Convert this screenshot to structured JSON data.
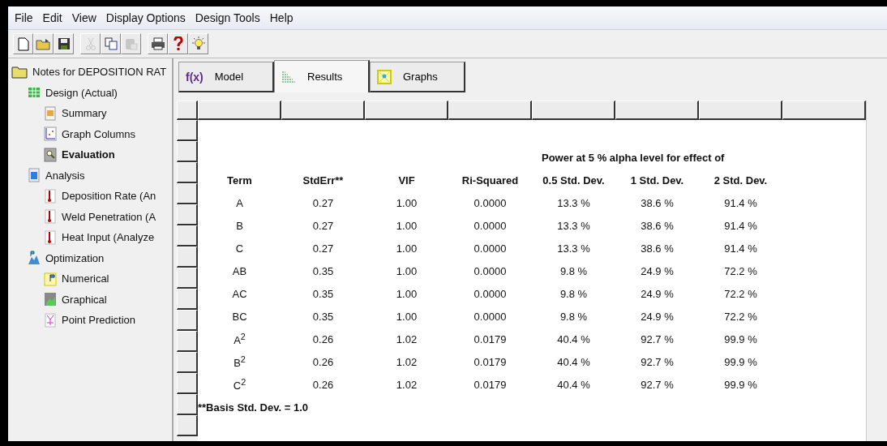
{
  "menu": [
    "File",
    "Edit",
    "View",
    "Display Options",
    "Design Tools",
    "Help"
  ],
  "toolbar": [
    [
      {
        "kind": "new",
        "disabled": false
      },
      {
        "kind": "open",
        "disabled": false
      },
      {
        "kind": "save",
        "disabled": false
      }
    ],
    [
      {
        "kind": "cut",
        "disabled": true
      },
      {
        "kind": "copy",
        "disabled": false
      },
      {
        "kind": "paste",
        "disabled": true
      }
    ],
    [
      {
        "kind": "print",
        "disabled": false
      },
      {
        "kind": "help",
        "disabled": false
      },
      {
        "kind": "tip",
        "disabled": false
      }
    ]
  ],
  "tree": {
    "label": "Notes for DEPOSITION RAT",
    "kind": "folder",
    "selected": false,
    "children": [
      {
        "label": "Design (Actual)",
        "kind": "grid",
        "selected": false,
        "children": [
          {
            "label": "Summary",
            "kind": "table",
            "selected": false
          },
          {
            "label": "Graph Columns",
            "kind": "chart",
            "selected": false
          },
          {
            "label": "Evaluation",
            "kind": "magnifier",
            "selected": true
          }
        ]
      },
      {
        "label": "Analysis",
        "kind": "calculator",
        "selected": false,
        "children": [
          {
            "label": "Deposition Rate (An",
            "kind": "thermometer",
            "selected": false
          },
          {
            "label": "Weld Penetration (A",
            "kind": "thermometer",
            "selected": false
          },
          {
            "label": "Heat Input (Analyze",
            "kind": "thermometer",
            "selected": false
          }
        ]
      },
      {
        "label": "Optimization",
        "kind": "mountain",
        "selected": false,
        "children": [
          {
            "label": "Numerical",
            "kind": "flag",
            "selected": false
          },
          {
            "label": "Graphical",
            "kind": "map",
            "selected": false
          },
          {
            "label": "Point Prediction",
            "kind": "target",
            "selected": false
          }
        ]
      }
    ]
  },
  "tabs": [
    {
      "label": "Model",
      "icon_text": "f(x)",
      "selected": false
    },
    {
      "label": "Results",
      "kind": "list",
      "selected": true
    },
    {
      "label": "Graphs",
      "kind": "graph",
      "selected": false
    }
  ],
  "table": {
    "group_heading": "Power at 5 % alpha level for effect of",
    "columns": [
      "Term",
      "StdErr**",
      "VIF",
      "Ri-Squared",
      "0.5 Std. Dev.",
      "1 Std. Dev.",
      "2 Std. Dev."
    ],
    "rows": [
      [
        "A",
        "0.27",
        "1.00",
        "0.0000",
        "13.3 %",
        "38.6 %",
        "91.4 %"
      ],
      [
        "B",
        "0.27",
        "1.00",
        "0.0000",
        "13.3 %",
        "38.6 %",
        "91.4 %"
      ],
      [
        "C",
        "0.27",
        "1.00",
        "0.0000",
        "13.3 %",
        "38.6 %",
        "91.4 %"
      ],
      [
        "AB",
        "0.35",
        "1.00",
        "0.0000",
        "9.8 %",
        "24.9 %",
        "72.2 %"
      ],
      [
        "AC",
        "0.35",
        "1.00",
        "0.0000",
        "9.8 %",
        "24.9 %",
        "72.2 %"
      ],
      [
        "BC",
        "0.35",
        "1.00",
        "0.0000",
        "9.8 %",
        "24.9 %",
        "72.2 %"
      ],
      [
        "A$^{2}$",
        "0.26",
        "1.02",
        "0.0179",
        "40.4 %",
        "92.7 %",
        "99.9 %"
      ],
      [
        "B$^{2}$",
        "0.26",
        "1.02",
        "0.0179",
        "40.4 %",
        "92.7 %",
        "99.9 %"
      ],
      [
        "C$^{2}$",
        "0.26",
        "1.02",
        "0.0179",
        "40.4 %",
        "92.7 %",
        "99.9 %"
      ]
    ],
    "footnote": "**Basis Std. Dev. = 1.0"
  }
}
